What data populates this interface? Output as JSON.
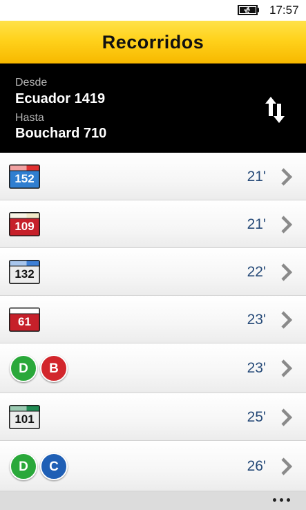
{
  "status_bar": {
    "time": "17:57",
    "icon": "battery-charging-icon"
  },
  "header": {
    "title": "Recorridos"
  },
  "route": {
    "from_label": "Desde",
    "from_value": "Ecuador 1419",
    "to_label": "Hasta",
    "to_value": "Bouchard 710",
    "swap_icon": "swap-arrows-icon"
  },
  "colors": {
    "header_yellow": "#ffd21c",
    "duration_text": "#264a78",
    "line_d_green": "#2aa83a",
    "line_b_red": "#d2262c",
    "line_c_blue": "#1f5fb5"
  },
  "trips": [
    {
      "type": "bus",
      "line": "152",
      "duration": "21'",
      "stripe": "#e03030",
      "body": "#2f7ed0",
      "text": "#ffffff"
    },
    {
      "type": "bus",
      "line": "109",
      "duration": "21'",
      "stripe": "#f2e9c8",
      "body": "#c6202a",
      "text": "#ffffff"
    },
    {
      "type": "bus",
      "line": "132",
      "duration": "22'",
      "stripe": "#3d7fd6",
      "body": "#ececec",
      "text": "#111111"
    },
    {
      "type": "bus",
      "line": "61",
      "duration": "23'",
      "stripe": "#ffffff",
      "body": "#c6202a",
      "text": "#ffffff"
    },
    {
      "type": "subway",
      "lines": [
        "D",
        "B"
      ],
      "duration": "23'"
    },
    {
      "type": "bus",
      "line": "101",
      "duration": "25'",
      "stripe": "#1f8a52",
      "body": "#ececec",
      "text": "#111111"
    },
    {
      "type": "subway",
      "lines": [
        "D",
        "C"
      ],
      "duration": "26'"
    }
  ],
  "app_bar": {
    "more_icon": "more-ellipsis-icon"
  }
}
